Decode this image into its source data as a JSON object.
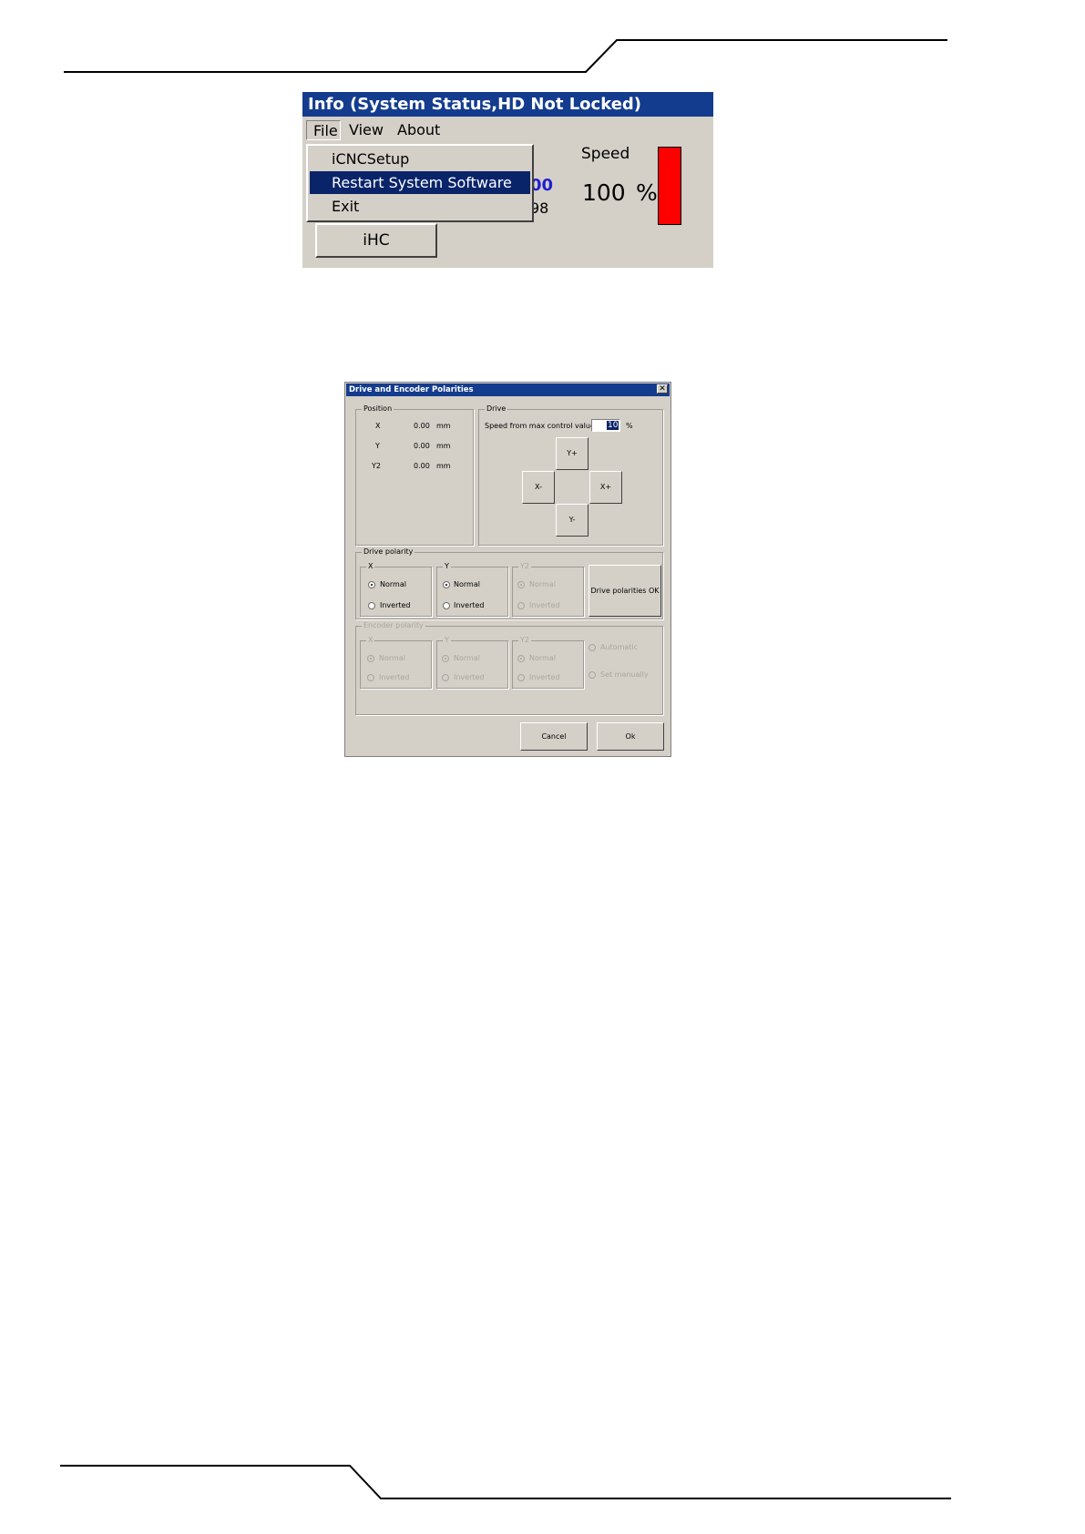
{
  "window1": {
    "title": "Info (System Status,HD Not Locked)",
    "menu": [
      "File",
      "View",
      "About"
    ],
    "dropdown": [
      "iCNCSetup",
      "Restart System Software",
      "Exit"
    ],
    "partial_value_1": "00",
    "partial_value_2": "98",
    "speed_label": "Speed",
    "speed_value": "100",
    "speed_unit": "%",
    "speed_bar_fraction": 1.0,
    "speed_bar_color": "#ff0000",
    "ihc_button": "iHC"
  },
  "dialog": {
    "title": "Drive and Encoder Polarities",
    "close_glyph": "✕",
    "position": {
      "label": "Position",
      "rows": [
        {
          "axis": "X",
          "value": "0.00",
          "unit": "mm"
        },
        {
          "axis": "Y",
          "value": "0.00",
          "unit": "mm"
        },
        {
          "axis": "Y2",
          "value": "0.00",
          "unit": "mm"
        }
      ]
    },
    "drive": {
      "label": "Drive",
      "speed_label": "Speed from max control value",
      "speed_value": "10",
      "speed_unit": "%",
      "buttons": {
        "yplus": "Y+",
        "xminus": "X-",
        "xplus": "X+",
        "yminus": "Y-"
      }
    },
    "drive_polarity": {
      "label": "Drive polarity",
      "groups": [
        {
          "label": "X",
          "normal": "Normal",
          "inverted": "Inverted"
        },
        {
          "label": "Y",
          "normal": "Normal",
          "inverted": "Inverted"
        },
        {
          "label": "Y2",
          "normal": "Normal",
          "inverted": "Inverted"
        }
      ],
      "ok_button": "Drive polarities OK"
    },
    "encoder_polarity": {
      "label": "Encoder polarity",
      "groups": [
        {
          "label": "X",
          "normal": "Normal",
          "inverted": "Inverted"
        },
        {
          "label": "Y",
          "normal": "Normal",
          "inverted": "Inverted"
        },
        {
          "label": "Y2",
          "normal": "Normal",
          "inverted": "Inverted"
        }
      ],
      "automatic": "Automatic",
      "set_manually": "Set manually"
    },
    "cancel_button": "Cancel",
    "ok_button": "Ok"
  }
}
